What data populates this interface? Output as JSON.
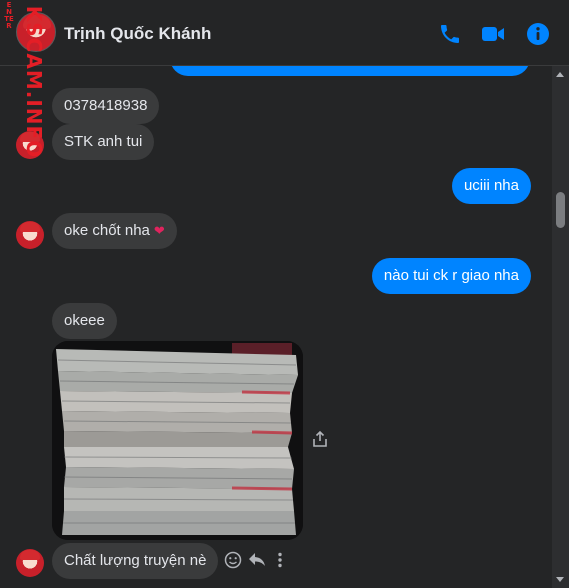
{
  "watermark": {
    "small": "ENTER",
    "big": "KSCAM.INFO"
  },
  "header": {
    "contact_name": "Trịnh Quốc Khánh",
    "icons": [
      "phone-icon",
      "video-icon",
      "info-icon"
    ],
    "accent_color": "#0084ff"
  },
  "messages": [
    {
      "sender": "me",
      "text": ""
    },
    {
      "sender": "them",
      "text": "0378418938"
    },
    {
      "sender": "them",
      "text": "STK anh tui"
    },
    {
      "sender": "me",
      "text": "uciii nha"
    },
    {
      "sender": "them",
      "text": "oke chốt nha",
      "emoji": "❤"
    },
    {
      "sender": "me",
      "text": "nào tui ck r giao nha"
    },
    {
      "sender": "them",
      "text": "okeee"
    },
    {
      "sender": "them",
      "type": "photo",
      "description": "stack of books"
    },
    {
      "sender": "them",
      "text": "Chất lượng truyện nè"
    }
  ],
  "colors": {
    "incoming_bubble": "#3a3b3c",
    "outgoing_bubble": "#0084ff",
    "background": "#242526"
  }
}
